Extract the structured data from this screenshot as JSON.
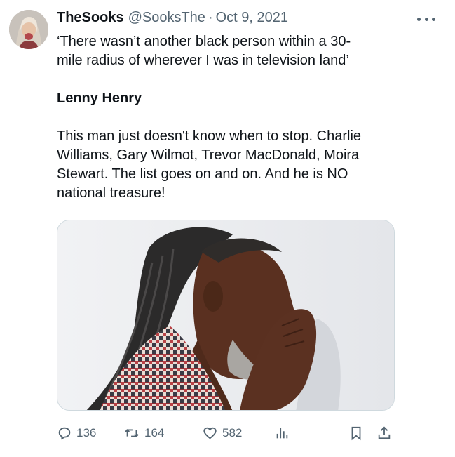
{
  "tweet": {
    "display_name": "TheSooks",
    "handle": "@SooksThe",
    "separator": "·",
    "date": "Oct 9, 2021",
    "text": {
      "quote": "‘There wasn’t another black person within a 30-\nmile radius of wherever I was in television land’",
      "attribution": "Lenny Henry",
      "body": "This man just doesn't know when to stop. Charlie\nWilliams, Gary Wilmot, Trevor MacDonald, Moira\nStewart. The list goes on and on. And he is NO\nnational treasure!"
    }
  },
  "actions": {
    "replies": "136",
    "retweets": "164",
    "likes": "582"
  },
  "icons": {
    "more": "more-horizontal-icon",
    "reply": "reply-icon",
    "retweet": "retweet-icon",
    "like": "heart-icon",
    "views": "views-chart-icon",
    "bookmark": "bookmark-icon",
    "share": "share-icon"
  },
  "colors": {
    "text_primary": "#0f1419",
    "text_secondary": "#536471",
    "border": "#cfd9de"
  }
}
